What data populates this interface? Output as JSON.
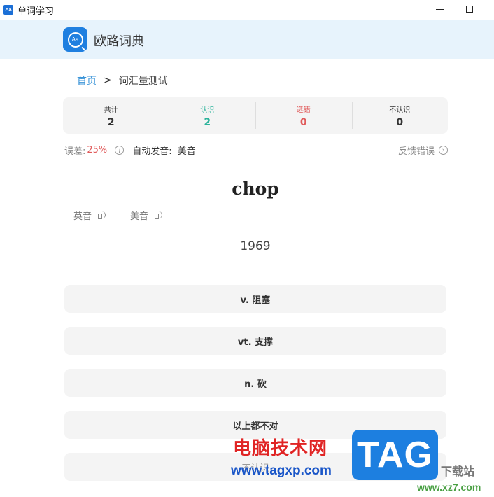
{
  "window": {
    "app_icon_text": "Aa",
    "title": "单词学习",
    "minimize_symbol": "",
    "maximize_symbol": ""
  },
  "header": {
    "brand_name": "欧路词典",
    "logo_text": "Aa"
  },
  "breadcrumb": {
    "home": "首页",
    "separator": ">",
    "current": "词汇量测试"
  },
  "stats": [
    {
      "label": "共计",
      "value": "2",
      "color": "#333333"
    },
    {
      "label": "认识",
      "value": "2",
      "color": "#2bb39b"
    },
    {
      "label": "选错",
      "value": "0",
      "color": "#e05a5a"
    },
    {
      "label": "不认识",
      "value": "0",
      "color": "#333333"
    }
  ],
  "meta": {
    "error_label": "误差:",
    "error_value": "25%",
    "auto_label": "自动发音:",
    "auto_value": "美音",
    "feedback_label": "反馈错误"
  },
  "word": {
    "text": "chop",
    "pron_uk_label": "英音",
    "pron_us_label": "美音",
    "rank": "1969"
  },
  "options": [
    {
      "label": "v. 阻塞"
    },
    {
      "label": "vt. 支撑"
    },
    {
      "label": "n. 砍"
    },
    {
      "label": "以上都不对"
    },
    {
      "label": "不认识"
    }
  ],
  "watermark": {
    "site_name": "电脑技术网",
    "site_url": "www.tagxp.com",
    "tag": "TAG",
    "side_text": "下载站",
    "side_url": "www.xz7.com"
  },
  "colors": {
    "accent_blue": "#3c95d8",
    "header_bg": "#e7f3fc",
    "known_green": "#2bb39b",
    "error_red": "#e05a5a"
  }
}
